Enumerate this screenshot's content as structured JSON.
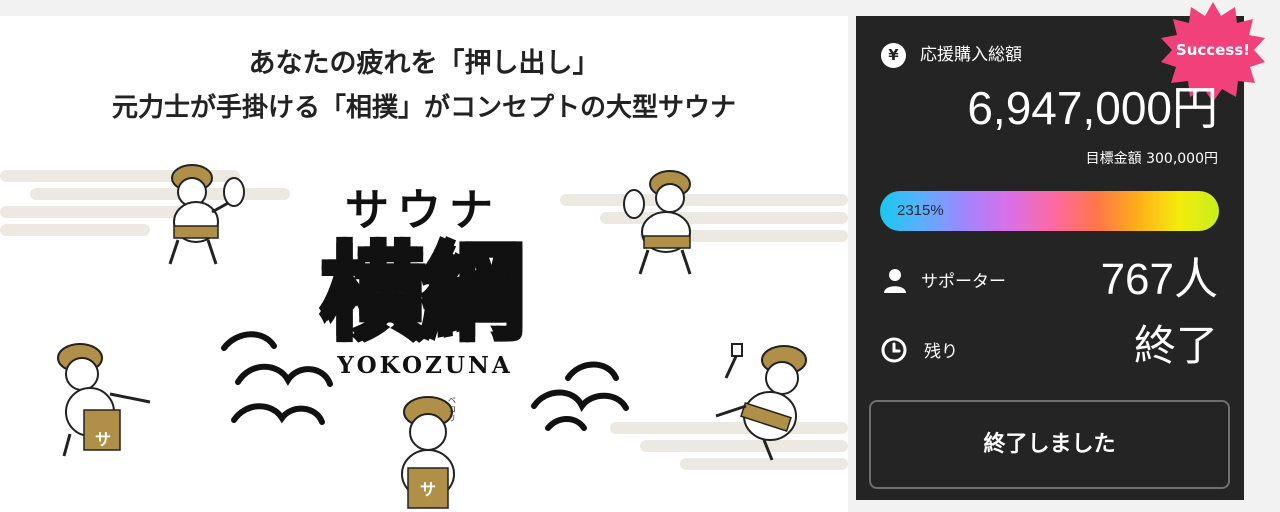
{
  "banner": {
    "headline_line1": "あなたの疲れを「押し出し」",
    "headline_line2": "元力士が手掛ける「相撲」がコンセプトの大型サウナ",
    "logo_top": "サウナ",
    "logo_main": "横綱",
    "logo_romaji": "YOKOZUNA",
    "apron_mark": "サ",
    "sfx": "ペコリ"
  },
  "panel": {
    "badge": "Success!",
    "total_label": "応援購入総額",
    "total_value": "6,947,000円",
    "goal_text": "目標金額 300,000円",
    "progress_percent": 2315,
    "progress_text": "2315%",
    "supporters_label": "サポーター",
    "supporters_value": "767人",
    "remaining_label": "残り",
    "remaining_value": "終了",
    "button_label": "終了しました",
    "yen_symbol": "¥"
  },
  "colors": {
    "panel_bg": "#242424",
    "badge_pink": "#f2417a",
    "button_border": "#6f6f6f",
    "wrestler_hat": "#b09048",
    "hero_bg": "#ffffff"
  },
  "icons": [
    "yen-icon",
    "user-icon",
    "clock-icon"
  ]
}
